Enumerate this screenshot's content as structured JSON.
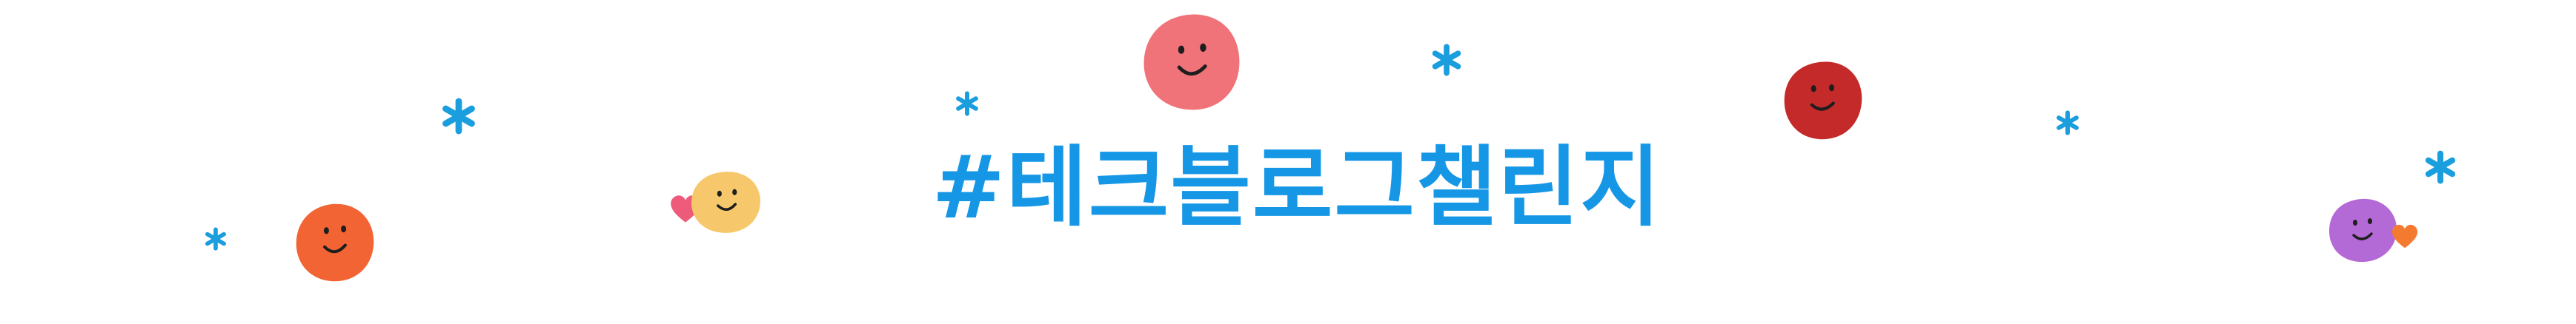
{
  "banner": {
    "hashtag_title": "#테크블로그챌린지"
  },
  "colors": {
    "title": "#1697e6",
    "sparkle": "#1a9ede",
    "face_pink": "#f0737a",
    "face_dark_red": "#c42a2a",
    "face_orange": "#f26434",
    "face_yellow": "#f7c86b",
    "face_purple": "#b46ad6",
    "heart_pink": "#ee5b7a",
    "heart_orange": "#f47a30",
    "eyes": "#1e1e1e"
  },
  "decorations": {
    "faces": [
      "smiley-face-icon",
      "smiley-face-icon",
      "smiley-face-icon",
      "smiley-face-icon",
      "smiley-face-icon"
    ],
    "hearts": [
      "heart-icon",
      "heart-icon"
    ],
    "sparkles": [
      "sparkle-icon"
    ]
  }
}
